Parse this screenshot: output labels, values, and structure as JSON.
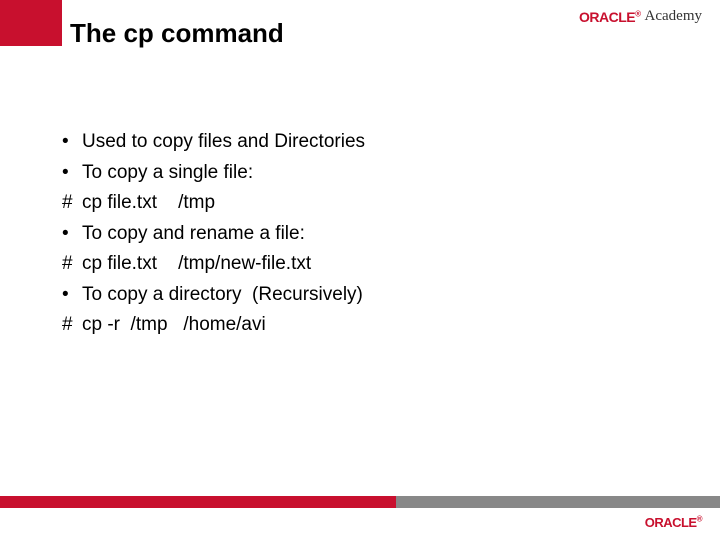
{
  "title": "The cp command",
  "logo": {
    "brand": "ORACLE",
    "reg": "®",
    "sub": "Academy"
  },
  "bullets": {
    "dot": "•",
    "hash": "#"
  },
  "lines": [
    {
      "mark": "dot",
      "text": "Used to copy files and Directories"
    },
    {
      "mark": "dot",
      "text": "To copy a single file:"
    },
    {
      "mark": "hash",
      "text": "cp file.txt    /tmp"
    },
    {
      "mark": "dot",
      "text": "To copy and rename a file:"
    },
    {
      "mark": "hash",
      "text": "cp file.txt    /tmp/new-file.txt"
    },
    {
      "mark": "dot",
      "text": "To copy a directory  (Recursively)"
    },
    {
      "mark": "hash",
      "text": "cp -r  /tmp   /home/avi"
    }
  ],
  "colors": {
    "oracle_red": "#c8102e"
  }
}
